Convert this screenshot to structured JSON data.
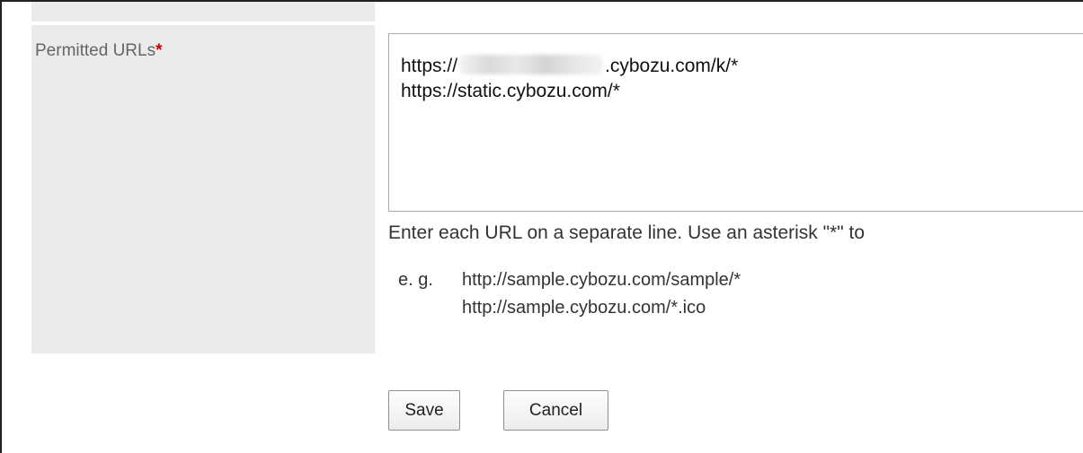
{
  "form": {
    "field_label": "Permitted URLs",
    "required_marker": "*",
    "permitted_urls": {
      "line1_prefix": "https://",
      "line1_suffix": ".cybozu.com/k/*",
      "line2": "https://static.cybozu.com/*"
    },
    "hint": "Enter each URL on a separate line. Use an asterisk \"*\" to",
    "example": {
      "prefix": "e. g.",
      "lines": [
        "http://sample.cybozu.com/sample/*",
        "http://sample.cybozu.com/*.ico"
      ]
    },
    "buttons": {
      "save_label": "Save",
      "cancel_label": "Cancel"
    }
  }
}
